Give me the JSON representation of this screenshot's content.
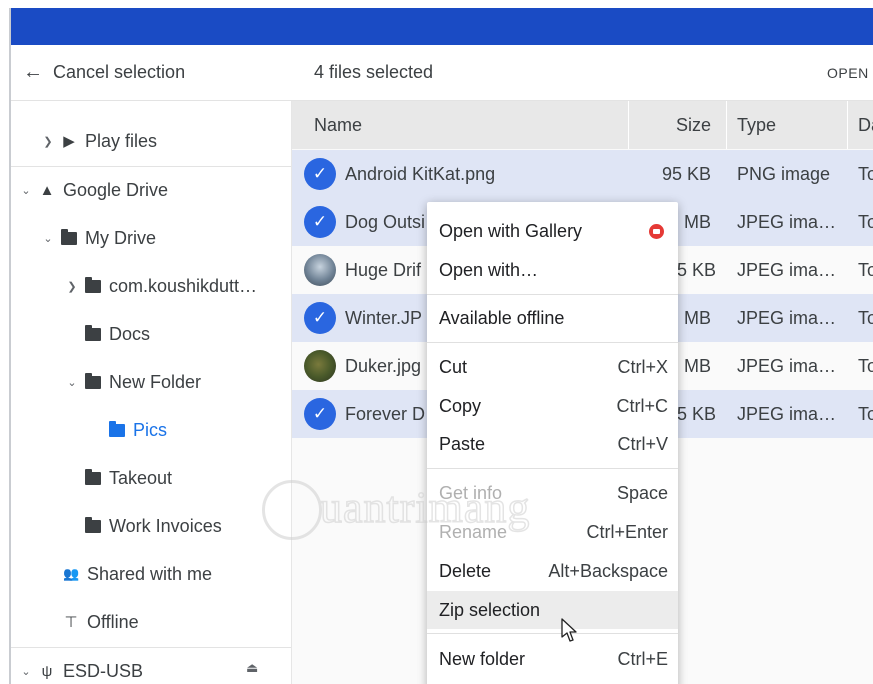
{
  "toolbar": {
    "cancel_label": "Cancel selection",
    "selected_count": "4 files selected",
    "open_label": "OPEN"
  },
  "sidebar": {
    "items": [
      {
        "label": "Play files",
        "icon": "play-files-icon"
      },
      {
        "label": "Google Drive",
        "icon": "google-drive-icon"
      },
      {
        "label": "My Drive",
        "icon": "my-drive-icon"
      },
      {
        "label": "com.koushikdutt…",
        "icon": "folder-icon"
      },
      {
        "label": "Docs",
        "icon": "folder-icon"
      },
      {
        "label": "New Folder",
        "icon": "folder-icon"
      },
      {
        "label": "Pics",
        "icon": "folder-icon"
      },
      {
        "label": "Takeout",
        "icon": "folder-icon"
      },
      {
        "label": "Work Invoices",
        "icon": "folder-icon"
      },
      {
        "label": "Shared with me",
        "icon": "people-icon"
      },
      {
        "label": "Offline",
        "icon": "pin-icon"
      },
      {
        "label": "ESD-USB",
        "icon": "usb-icon"
      }
    ]
  },
  "filelist": {
    "columns": [
      "Name",
      "Size",
      "Type",
      "Da"
    ],
    "rows": [
      {
        "name": "Android KitKat.png",
        "size": "95 KB",
        "type": "PNG image",
        "date": "To",
        "selected": true
      },
      {
        "name": "Dog Outsi",
        "size": "MB",
        "type": "JPEG ima…",
        "date": "To",
        "selected": true
      },
      {
        "name": "Huge Drif",
        "size": "5 KB",
        "type": "JPEG ima…",
        "date": "To",
        "selected": false
      },
      {
        "name": "Winter.JP",
        "size": "MB",
        "type": "JPEG ima…",
        "date": "To",
        "selected": true
      },
      {
        "name": "Duker.jpg",
        "size": "MB",
        "type": "JPEG ima…",
        "date": "To",
        "selected": false
      },
      {
        "name": "Forever D",
        "size": "5 KB",
        "type": "JPEG ima…",
        "date": "To",
        "selected": true
      }
    ]
  },
  "context_menu": {
    "items": [
      {
        "label": "Open with Gallery",
        "shortcut": ""
      },
      {
        "label": "Open with…",
        "shortcut": ""
      },
      {
        "label": "Available offline",
        "shortcut": ""
      },
      {
        "label": "Cut",
        "shortcut": "Ctrl+X"
      },
      {
        "label": "Copy",
        "shortcut": "Ctrl+C"
      },
      {
        "label": "Paste",
        "shortcut": "Ctrl+V"
      },
      {
        "label": "Get info",
        "shortcut": "Space"
      },
      {
        "label": "Rename",
        "shortcut": "Ctrl+Enter"
      },
      {
        "label": "Delete",
        "shortcut": "Alt+Backspace"
      },
      {
        "label": "Zip selection",
        "shortcut": ""
      },
      {
        "label": "New folder",
        "shortcut": "Ctrl+E"
      }
    ]
  },
  "watermark": "uantrimang",
  "colors": {
    "topbar": "#1a4bc4",
    "selected_row": "#dfe5f5",
    "checkmark": "#2a66e0",
    "active_nav": "#1a73e8"
  }
}
